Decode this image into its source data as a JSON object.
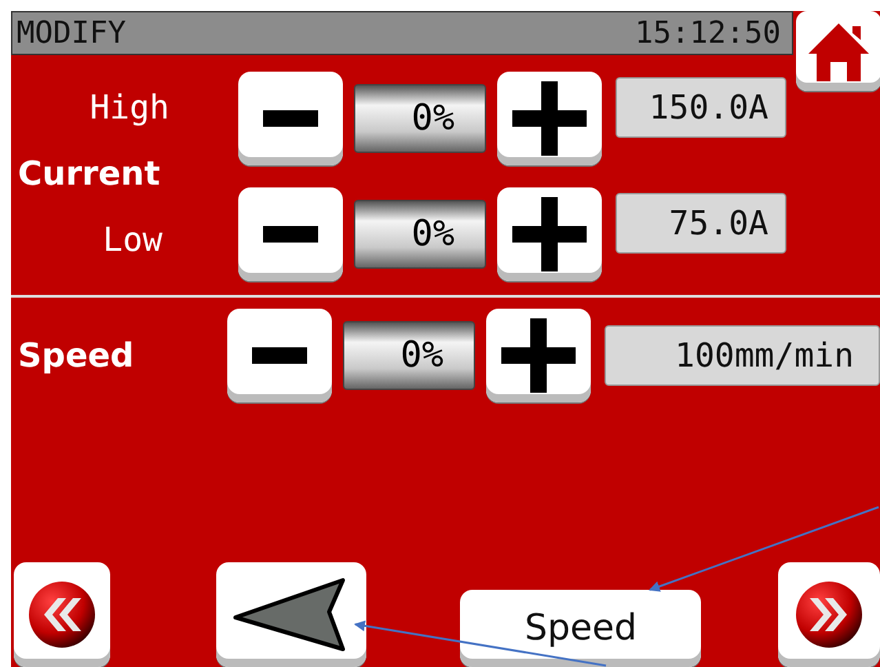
{
  "header": {
    "title": "MODIFY",
    "time": "15:12:50"
  },
  "current": {
    "label": "Current",
    "rows": [
      {
        "label": "High",
        "value": "0%",
        "reading": "150.0A"
      },
      {
        "label": "Low",
        "value": "0%",
        "reading": "75.0A"
      }
    ]
  },
  "speed": {
    "label": "Speed",
    "value": "0%",
    "reading": "100mm/min"
  },
  "nav": [
    {
      "kind": "rewind"
    },
    {
      "kind": "back"
    },
    {
      "kind": "label",
      "text": "Speed"
    },
    {
      "kind": "forward"
    }
  ],
  "annotations": [
    {
      "kind": "arrow"
    },
    {
      "kind": "arrow"
    }
  ]
}
